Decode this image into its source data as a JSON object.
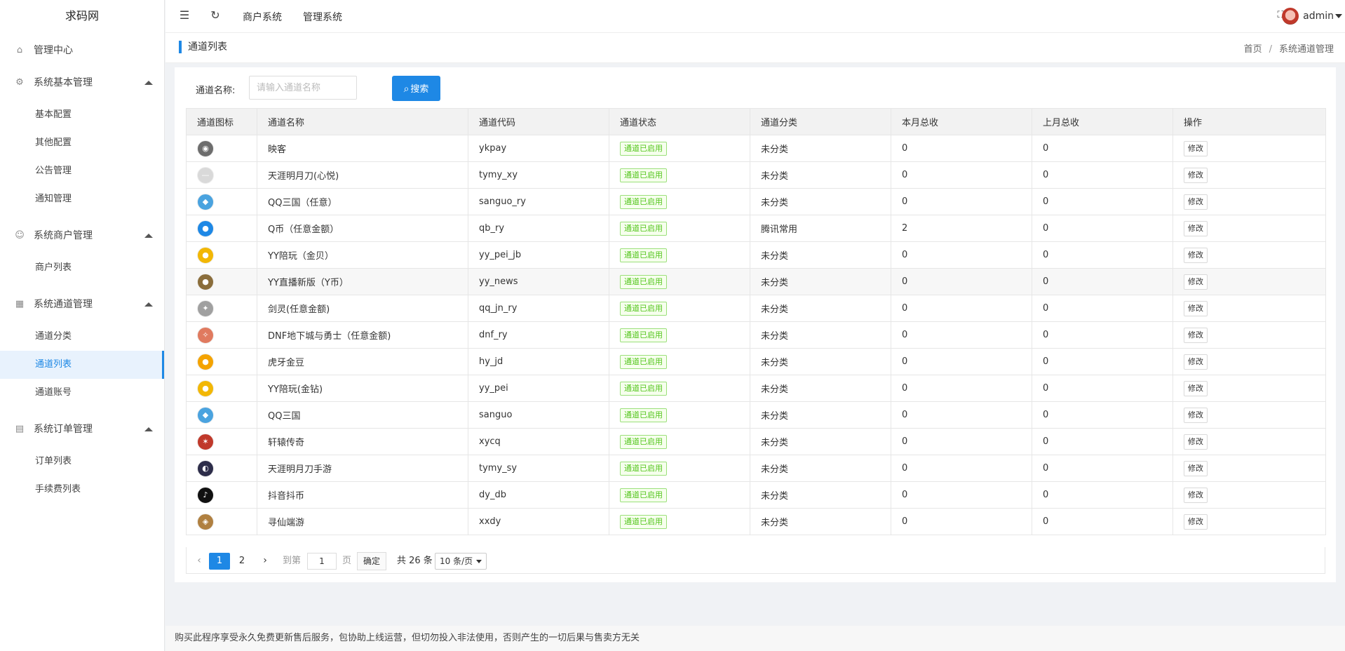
{
  "brand": "求码网",
  "sidebar": {
    "groups": [
      {
        "label": "管理中心",
        "icon": "home-icon",
        "items": []
      },
      {
        "label": "系统基本管理",
        "icon": "gear-icon",
        "items": [
          "基本配置",
          "其他配置",
          "公告管理",
          "通知管理"
        ]
      },
      {
        "label": "系统商户管理",
        "icon": "user-icon",
        "items": [
          "商户列表"
        ]
      },
      {
        "label": "系统通道管理",
        "icon": "table-icon",
        "items": [
          "通道分类",
          "通道列表",
          "通道账号"
        ]
      },
      {
        "label": "系统订单管理",
        "icon": "document-icon",
        "items": [
          "订单列表",
          "手续费列表"
        ]
      }
    ],
    "active_item": "通道列表"
  },
  "topbar": {
    "menu_icon": "menu-fold-icon",
    "refresh_icon": "refresh-icon",
    "links": [
      "商户系统",
      "管理系统"
    ],
    "fullscreen_icon": "fullscreen-icon",
    "user": "admin"
  },
  "page": {
    "title": "通道列表",
    "breadcrumb": [
      "首页",
      "/",
      "系统通道管理"
    ]
  },
  "search": {
    "label": "通道名称:",
    "placeholder": "请输入通道名称",
    "value": "",
    "button": "搜索"
  },
  "table": {
    "columns": [
      "通道图标",
      "通道名称",
      "通道代码",
      "通道状态",
      "通道分类",
      "本月总收",
      "上月总收",
      "操作"
    ],
    "rows": [
      {
        "icon": "raccoon-icon",
        "name": "映客",
        "code": "ykpay",
        "status": "通道已启用",
        "category": "未分类",
        "this_month": "0",
        "last_month": "0",
        "action": "修改"
      },
      {
        "icon": "sword-icon",
        "name": "天涯明月刀(心悦)",
        "code": "tymy_xy",
        "status": "通道已启用",
        "category": "未分类",
        "this_month": "0",
        "last_month": "0",
        "action": "修改"
      },
      {
        "icon": "qq-sanguo-icon",
        "name": "QQ三国（任意）",
        "code": "sanguo_ry",
        "status": "通道已启用",
        "category": "未分类",
        "this_month": "0",
        "last_month": "0",
        "action": "修改"
      },
      {
        "icon": "qq-penguin-icon",
        "name": "Q币（任意金额）",
        "code": "qb_ry",
        "status": "通道已启用",
        "category": "腾讯常用",
        "this_month": "2",
        "last_month": "0",
        "action": "修改"
      },
      {
        "icon": "yy-bear-icon",
        "name": "YY陪玩（金贝）",
        "code": "yy_pei_jb",
        "status": "通道已启用",
        "category": "未分类",
        "this_month": "0",
        "last_month": "0",
        "action": "修改"
      },
      {
        "icon": "yy-live-icon",
        "name": "YY直播新版（Y币）",
        "code": "yy_news",
        "status": "通道已启用",
        "category": "未分类",
        "this_month": "0",
        "last_month": "0",
        "action": "修改"
      },
      {
        "icon": "jianling-icon",
        "name": "剑灵(任意金额)",
        "code": "qq_jn_ry",
        "status": "通道已启用",
        "category": "未分类",
        "this_month": "0",
        "last_month": "0",
        "action": "修改"
      },
      {
        "icon": "dnf-icon",
        "name": "DNF地下城与勇士（任意金额)",
        "code": "dnf_ry",
        "status": "通道已启用",
        "category": "未分类",
        "this_month": "0",
        "last_month": "0",
        "action": "修改"
      },
      {
        "icon": "huya-icon",
        "name": "虎牙金豆",
        "code": "hy_jd",
        "status": "通道已启用",
        "category": "未分类",
        "this_month": "0",
        "last_month": "0",
        "action": "修改"
      },
      {
        "icon": "yy-bear-icon",
        "name": "YY陪玩(金钻)",
        "code": "yy_pei",
        "status": "通道已启用",
        "category": "未分类",
        "this_month": "0",
        "last_month": "0",
        "action": "修改"
      },
      {
        "icon": "qq-sanguo-icon",
        "name": "QQ三国",
        "code": "sanguo",
        "status": "通道已启用",
        "category": "未分类",
        "this_month": "0",
        "last_month": "0",
        "action": "修改"
      },
      {
        "icon": "xuanyuan-icon",
        "name": "轩辕传奇",
        "code": "xycq",
        "status": "通道已启用",
        "category": "未分类",
        "this_month": "0",
        "last_month": "0",
        "action": "修改"
      },
      {
        "icon": "tymy-mobile-icon",
        "name": "天涯明月刀手游",
        "code": "tymy_sy",
        "status": "通道已启用",
        "category": "未分类",
        "this_month": "0",
        "last_month": "0",
        "action": "修改"
      },
      {
        "icon": "tiktok-icon",
        "name": "抖音抖币",
        "code": "dy_db",
        "status": "通道已启用",
        "category": "未分类",
        "this_month": "0",
        "last_month": "0",
        "action": "修改"
      },
      {
        "icon": "xunxian-icon",
        "name": "寻仙端游",
        "code": "xxdy",
        "status": "通道已启用",
        "category": "未分类",
        "this_month": "0",
        "last_month": "0",
        "action": "修改"
      }
    ],
    "highlighted_row": 5
  },
  "pagination": {
    "pages": [
      "1",
      "2"
    ],
    "current": "1",
    "goto_label": "到第",
    "goto_value": "1",
    "page_unit": "页",
    "confirm": "确定",
    "total": "共 26 条",
    "page_size": "10 条/页"
  },
  "footer": "购买此程序享受永久免费更新售后服务，包协助上线运营，但切勿投入非法使用，否则产生的一切后果与售卖方无关",
  "colors": {
    "primary": "#1e88e5",
    "status_green": "#52c41a"
  }
}
